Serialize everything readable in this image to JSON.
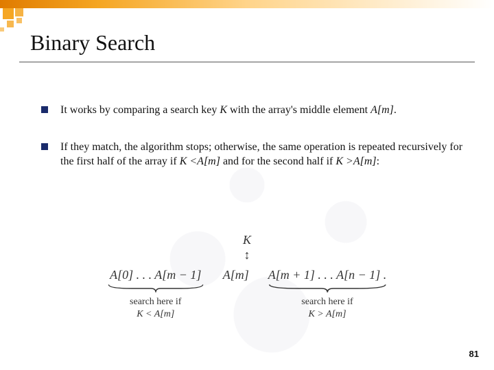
{
  "title": "Binary Search",
  "bullets": [
    {
      "pre": "It works by comparing a search key ",
      "k": "K",
      "mid": " with the array's middle element ",
      "am": "A[m]",
      "post": "."
    },
    {
      "pre": "If they match, the algorithm stops; otherwise, the same operation is repeated recursively for the first half of the array if ",
      "cond1_a": "K <",
      "cond1_b": "A[m]",
      "mid": " and for the second half if ",
      "cond2_a": "K >",
      "cond2_b": "A[m]",
      "post": ":"
    }
  ],
  "diagram": {
    "k": "K",
    "arrow": "↕",
    "left_expr": "A[0] . . . A[m − 1]",
    "mid_expr": "A[m]",
    "right_expr": "A[m + 1] . . . A[n − 1] .",
    "left_caption_l1": "search here if",
    "left_caption_l2": "K < A[m]",
    "right_caption_l1": "search here if",
    "right_caption_l2": "K > A[m]"
  },
  "page_number": "81"
}
